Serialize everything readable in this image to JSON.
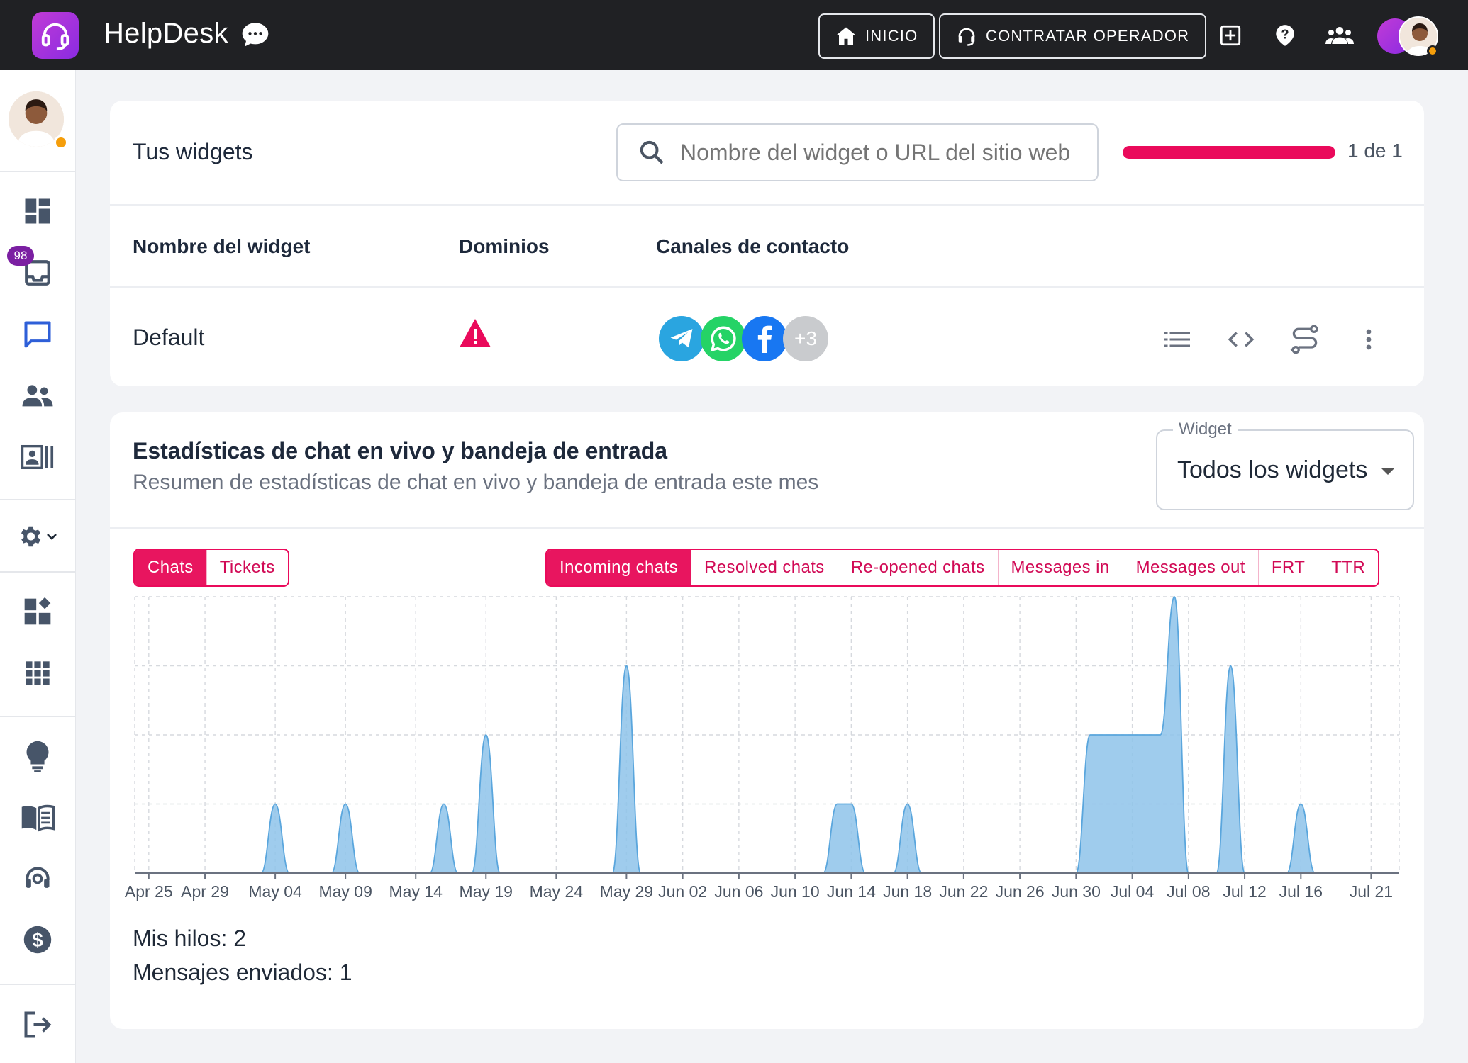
{
  "app": {
    "title": "HelpDesk"
  },
  "topbar": {
    "buttons": [
      {
        "label": "INICIO",
        "icon": "home-icon"
      },
      {
        "label": "CONTRATAR OPERADOR",
        "icon": "headset-icon"
      }
    ],
    "icons": [
      "add-box-icon",
      "help-icon",
      "team-icon"
    ],
    "avatar_status_color": "#f59e0b"
  },
  "sidebar": {
    "inbox_badge": "98",
    "items": [
      "dashboard-icon",
      "inbox-icon",
      "chat-icon",
      "contacts-icon",
      "contact-card-icon",
      "settings-icon",
      "widgets-icon",
      "apps-icon",
      "ideas-icon",
      "knowledge-base-icon",
      "operator-icon",
      "billing-icon",
      "logout-icon"
    ]
  },
  "widgets_card": {
    "title": "Tus widgets",
    "search_placeholder": "Nombre del widget o URL del sitio web",
    "progress_fraction": 1.0,
    "pager": "1 de 1",
    "columns": [
      "Nombre del widget",
      "Dominios",
      "Canales de contacto"
    ],
    "rows": [
      {
        "name": "Default",
        "domains_status": "warning",
        "channels": [
          "telegram",
          "whatsapp",
          "facebook"
        ],
        "extra_channels": "+3"
      }
    ]
  },
  "stats_card": {
    "title": "Estadísticas de chat en vivo y bandeja de entrada",
    "subtitle": "Resumen de estadísticas de chat en vivo y bandeja de entrada este mes",
    "select_label": "Widget",
    "select_value": "Todos los widgets",
    "type_tabs": [
      "Chats",
      "Tickets"
    ],
    "active_type": "Chats",
    "metric_tabs": [
      "Incoming chats",
      "Resolved chats",
      "Re-opened chats",
      "Messages in",
      "Messages out",
      "FRT",
      "TTR"
    ],
    "active_metric": "Incoming chats",
    "my_threads": "Mis hilos: 2",
    "messages_sent": "Mensajes enviados: 1"
  },
  "colors": {
    "accent": "#e8155f",
    "area_fill": "#8ec3ea",
    "area_stroke": "#5aa6dd"
  },
  "chart_data": {
    "type": "area",
    "x": [
      "Apr 24",
      "Apr 25",
      "Apr 26",
      "Apr 27",
      "Apr 28",
      "Apr 29",
      "Apr 30",
      "May 01",
      "May 02",
      "May 03",
      "May 04",
      "May 05",
      "May 06",
      "May 07",
      "May 08",
      "May 09",
      "May 10",
      "May 11",
      "May 12",
      "May 13",
      "May 14",
      "May 15",
      "May 16",
      "May 17",
      "May 18",
      "May 19",
      "May 20",
      "May 21",
      "May 22",
      "May 23",
      "May 24",
      "May 25",
      "May 26",
      "May 27",
      "May 28",
      "May 29",
      "May 30",
      "May 31",
      "Jun 01",
      "Jun 02",
      "Jun 03",
      "Jun 04",
      "Jun 05",
      "Jun 06",
      "Jun 07",
      "Jun 08",
      "Jun 09",
      "Jun 10",
      "Jun 11",
      "Jun 12",
      "Jun 13",
      "Jun 14",
      "Jun 15",
      "Jun 16",
      "Jun 17",
      "Jun 18",
      "Jun 19",
      "Jun 20",
      "Jun 21",
      "Jun 22",
      "Jun 23",
      "Jun 24",
      "Jun 25",
      "Jun 26",
      "Jun 27",
      "Jun 28",
      "Jun 29",
      "Jun 30",
      "Jul 01",
      "Jul 02",
      "Jul 03",
      "Jul 04",
      "Jul 05",
      "Jul 06",
      "Jul 07",
      "Jul 08",
      "Jul 09",
      "Jul 10",
      "Jul 11",
      "Jul 12",
      "Jul 13",
      "Jul 14",
      "Jul 15",
      "Jul 16",
      "Jul 17",
      "Jul 18",
      "Jul 19",
      "Jul 20",
      "Jul 21",
      "Jul 22",
      "Jul 23"
    ],
    "values": [
      0,
      0,
      0,
      0,
      0,
      0,
      0,
      0,
      0,
      0,
      1,
      0,
      0,
      0,
      0,
      1,
      0,
      0,
      0,
      0,
      0,
      0,
      1,
      0,
      0,
      2,
      0,
      0,
      0,
      0,
      0,
      0,
      0,
      0,
      0,
      3,
      0,
      0,
      0,
      0,
      0,
      0,
      0,
      0,
      0,
      0,
      0,
      0,
      0,
      0,
      1,
      1,
      0,
      0,
      0,
      1,
      0,
      0,
      0,
      0,
      0,
      0,
      0,
      0,
      0,
      0,
      0,
      0,
      2,
      2,
      2,
      2,
      2,
      2,
      4,
      0,
      0,
      0,
      3,
      0,
      0,
      0,
      0,
      1,
      0,
      0,
      0,
      0,
      0,
      0,
      0
    ],
    "tick_labels": [
      "Apr 25",
      "Apr 29",
      "May 04",
      "May 09",
      "May 14",
      "May 19",
      "May 24",
      "May 29",
      "Jun 02",
      "Jun 06",
      "Jun 10",
      "Jun 14",
      "Jun 18",
      "Jun 22",
      "Jun 26",
      "Jun 30",
      "Jul 04",
      "Jul 08",
      "Jul 12",
      "Jul 16",
      "Jul 21"
    ],
    "ylim": [
      0,
      4
    ],
    "grid": true,
    "legend": "none"
  }
}
